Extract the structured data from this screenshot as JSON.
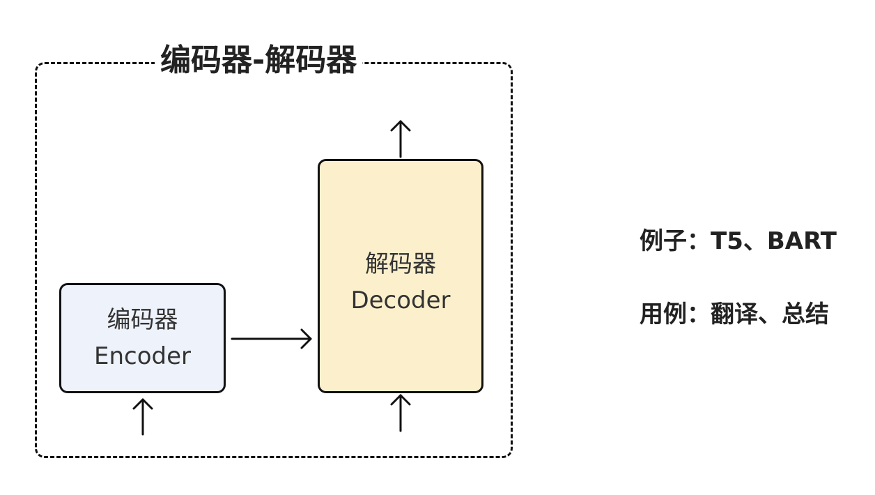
{
  "diagram": {
    "title": "编码器-解码器",
    "encoder": {
      "label_zh": "编码器",
      "label_en": "Encoder",
      "fill": "#eef2fb"
    },
    "decoder": {
      "label_zh": "解码器",
      "label_en": "Decoder",
      "fill": "#fcf0cc"
    },
    "notes": {
      "examples": "例子：T5、BART",
      "use_cases": "用例：翻译、总结"
    }
  }
}
